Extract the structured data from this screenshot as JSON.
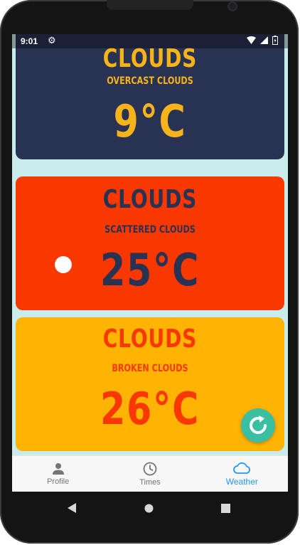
{
  "status_bar": {
    "time": "9:01"
  },
  "cards": [
    {
      "main": "CLOUDS",
      "description": "OVERCAST CLOUDS",
      "temperature": "9°C",
      "bg": "#283252",
      "fg": "#f7b31a"
    },
    {
      "main": "CLOUDS",
      "description": "SCATTERED CLOUDS",
      "temperature": "25°C",
      "bg": "#f93800",
      "fg": "#283252"
    },
    {
      "main": "CLOUDS",
      "description": "BROKEN CLOUDS",
      "temperature": "26°C",
      "bg": "#ffb302",
      "fg": "#f93800"
    }
  ],
  "bottom_nav": {
    "items": [
      {
        "label": "Profile",
        "icon": "person-icon",
        "active": false
      },
      {
        "label": "Times",
        "icon": "clock-icon",
        "active": false
      },
      {
        "label": "Weather",
        "icon": "cloud-icon",
        "active": true
      }
    ]
  },
  "colors": {
    "accent": "#2196f3",
    "fab": "#3bbfa3",
    "screen_bg": "#c9ecec"
  },
  "system_nav": [
    "back-icon",
    "home-icon",
    "recents-icon"
  ]
}
